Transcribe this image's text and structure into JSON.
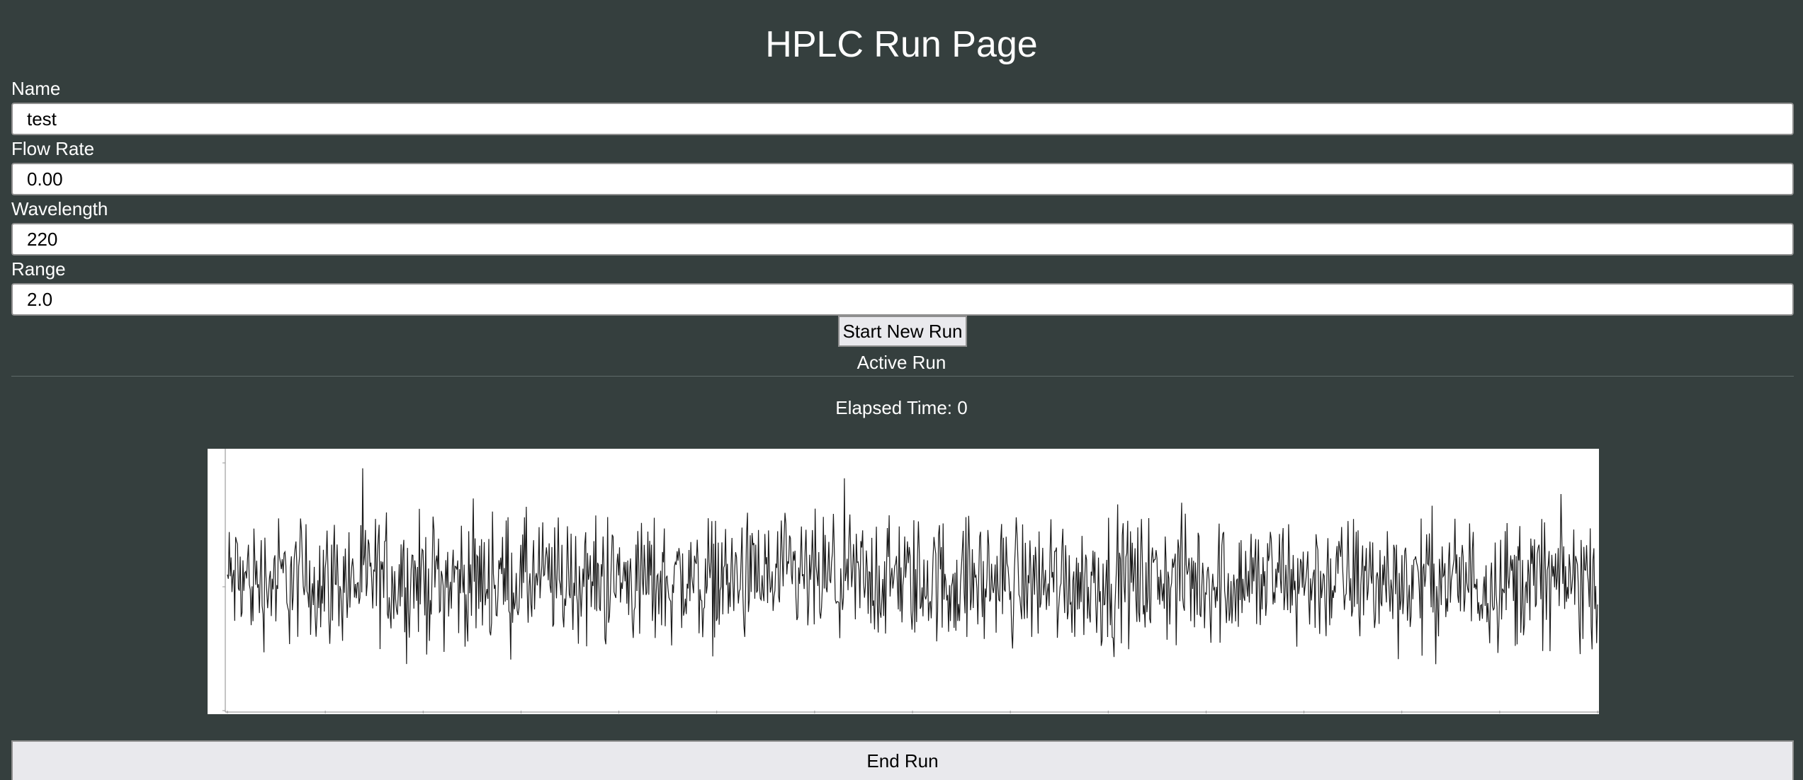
{
  "page": {
    "title": "HPLC Run Page"
  },
  "form": {
    "name": {
      "label": "Name",
      "value": "test"
    },
    "flow_rate": {
      "label": "Flow Rate",
      "value": "0.00"
    },
    "wavelength": {
      "label": "Wavelength",
      "value": "220"
    },
    "range": {
      "label": "Range",
      "value": "2.0"
    }
  },
  "actions": {
    "start_label": "Start New Run",
    "end_label": "End Run"
  },
  "active_run": {
    "heading": "Active Run",
    "elapsed_label": "Elapsed Time: 0"
  },
  "colors": {
    "background": "#353f3e",
    "trace": "#1a1a1a"
  },
  "chart_data": {
    "type": "line",
    "series": [
      {
        "values": []
      }
    ],
    "ylim": [
      -1,
      1
    ],
    "grid": false
  }
}
